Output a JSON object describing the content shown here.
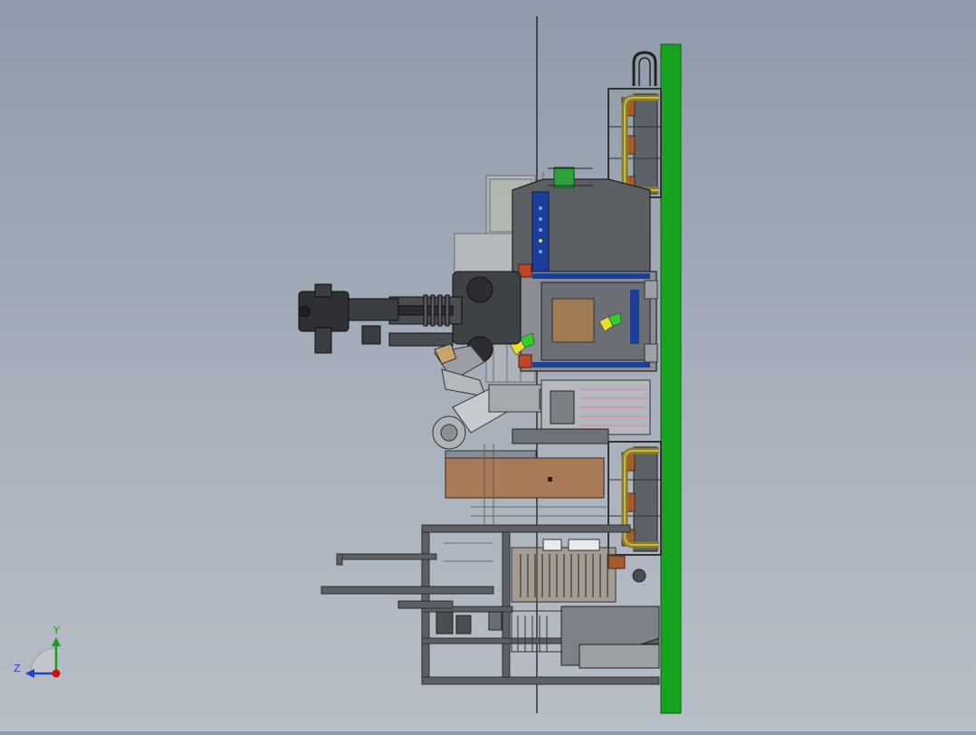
{
  "viewport": {
    "background_top": "#8f9aaa",
    "background_bottom": "#b8bec6"
  },
  "triad": {
    "y_label": "Y",
    "z_label": "Z",
    "y_color": "#1aa01a",
    "z_color": "#2040d0",
    "origin_color": "#d01010"
  },
  "model": {
    "icon": "cad-assembly-side-view",
    "base_plate_color": "#16a31e",
    "frame_color": "#3c3f44",
    "accent_blue": "#1c3f9a",
    "pipe_color": "#9a8a2a",
    "wood_color": "#a87a58",
    "highlight_green": "#2ed02e",
    "highlight_yellow": "#e6e02a"
  }
}
